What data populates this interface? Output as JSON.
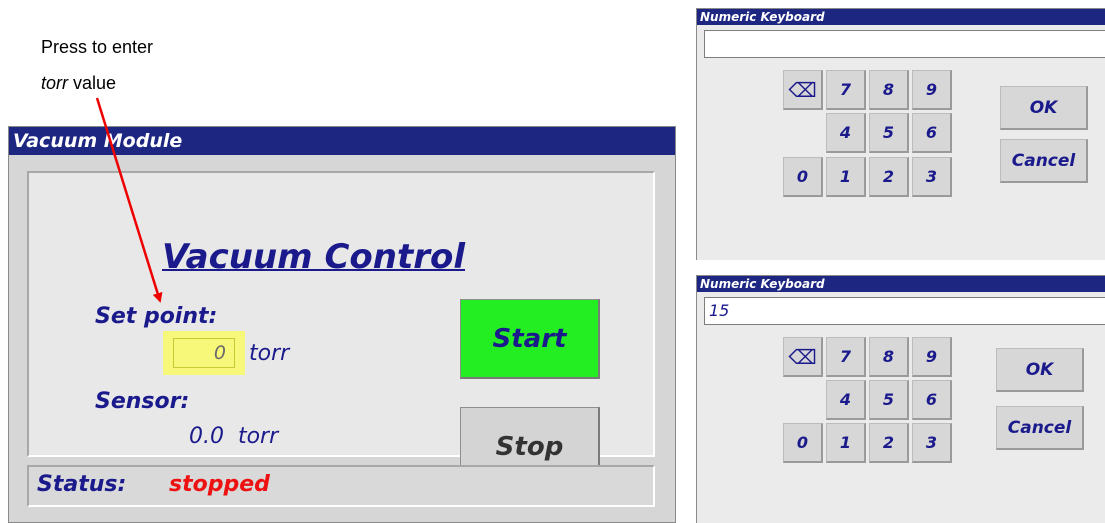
{
  "annotation": {
    "line1": "Press to enter",
    "line2_italic": "torr",
    "line2_rest": " value"
  },
  "vacuum_module": {
    "window_title": "Vacuum Module",
    "heading": "Vacuum Control",
    "setpoint_label": "Set point:",
    "setpoint_value": "0",
    "setpoint_unit": "torr",
    "sensor_label": "Sensor:",
    "sensor_reading": "0.0  torr",
    "start_label": "Start",
    "stop_label": "Stop",
    "status_label": "Status:",
    "status_value": "stopped"
  },
  "keyboards": [
    {
      "title": "Numeric Keyboard",
      "display_value": "",
      "keys": {
        "backspace": "⌫",
        "seven": "7",
        "eight": "8",
        "nine": "9",
        "four": "4",
        "five": "5",
        "six": "6",
        "zero": "0",
        "one": "1",
        "two": "2",
        "three": "3"
      },
      "ok_label": "OK",
      "cancel_label": "Cancel"
    },
    {
      "title": "Numeric Keyboard",
      "display_value": "15",
      "keys": {
        "backspace": "⌫",
        "seven": "7",
        "eight": "8",
        "nine": "9",
        "four": "4",
        "five": "5",
        "six": "6",
        "zero": "0",
        "one": "1",
        "two": "2",
        "three": "3"
      },
      "ok_label": "OK",
      "cancel_label": "Cancel"
    }
  ],
  "colors": {
    "titlebar": "#1d2782",
    "text_blue": "#1a1a8c",
    "start_green": "#22ee22",
    "status_red": "#ee1111",
    "setpoint_highlight": "#f7f77a",
    "annotation_arrow": "#ee0000"
  }
}
